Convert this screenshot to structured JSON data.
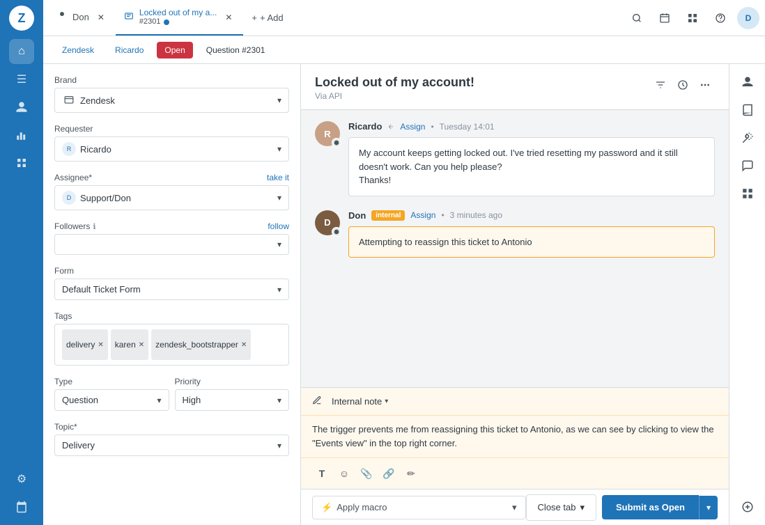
{
  "app": {
    "title": "Zendesk"
  },
  "tabs": [
    {
      "id": "don",
      "label": "Don",
      "icon": "person",
      "active": false,
      "closable": true
    },
    {
      "id": "ticket2301",
      "label": "Locked out of my a...",
      "sub": "#2301",
      "icon": "ticket",
      "active": true,
      "closable": true,
      "has_dot": true
    }
  ],
  "add_tab_label": "+ Add",
  "breadcrumb": {
    "zendesk": "Zendesk",
    "ricardo": "Ricardo",
    "open": "Open",
    "question": "Question #2301"
  },
  "left_panel": {
    "brand_label": "Brand",
    "brand_value": "Zendesk",
    "requester_label": "Requester",
    "requester_value": "Ricardo",
    "assignee_label": "Assignee*",
    "assignee_value": "Support/Don",
    "assignee_action": "take it",
    "followers_label": "Followers",
    "followers_action": "follow",
    "form_label": "Form",
    "form_value": "Default Ticket Form",
    "tags_label": "Tags",
    "tags": [
      {
        "id": "delivery",
        "label": "delivery"
      },
      {
        "id": "karen",
        "label": "karen"
      },
      {
        "id": "zendesk_bootstrapper",
        "label": "zendesk_bootstrapper"
      }
    ],
    "type_label": "Type",
    "type_value": "Question",
    "priority_label": "Priority",
    "priority_value": "High",
    "topic_label": "Topic*",
    "topic_value": "Delivery"
  },
  "ticket": {
    "title": "Locked out of my account!",
    "via": "Via API"
  },
  "messages": [
    {
      "id": "msg1",
      "author": "Ricardo",
      "action_label": "Assign",
      "time": "Tuesday 14:01",
      "avatar_initials": "R",
      "avatar_color": "#c8d7e1",
      "body": "My account keeps getting locked out. I've tried resetting my password and it still doesn't work. Can you help please?\nThanks!",
      "type": "public"
    },
    {
      "id": "msg2",
      "author": "Don",
      "badge": "internal",
      "badge_label": "internal",
      "action_label": "Assign",
      "time": "3 minutes ago",
      "avatar_initials": "D",
      "avatar_color": "#8a6b4f",
      "body": "Attempting to reassign this ticket to Antonio",
      "type": "internal"
    }
  ],
  "reply": {
    "type_label": "Internal note",
    "type_chevron": "▾",
    "text": "The trigger prevents me from reassigning this ticket to Antonio, as we can see by clicking to view the \"Events view\" in the top right corner.",
    "toolbar": {
      "format_icon": "T",
      "emoji_icon": "☺",
      "attach_icon": "📎",
      "link_icon": "🔗",
      "edit_icon": "✏"
    }
  },
  "bottom_bar": {
    "macro_icon": "⚡",
    "macro_label": "Apply macro",
    "close_tab_label": "Close tab",
    "close_tab_chevron": "▾",
    "submit_label": "Submit as Open"
  },
  "nav": {
    "home_icon": "⌂",
    "views_icon": "☰",
    "contacts_icon": "👤",
    "reporting_icon": "📊",
    "apps_icon": "⬛",
    "settings_icon": "⚙",
    "calendar_icon": "📅",
    "zendesk_icon": "Z"
  },
  "side_panel": {
    "user_icon": "👤",
    "knowledge_icon": "📖",
    "magic_icon": "✨",
    "chat_icon": "💬",
    "apps_icon": "⬛",
    "plus_icon": "+"
  }
}
